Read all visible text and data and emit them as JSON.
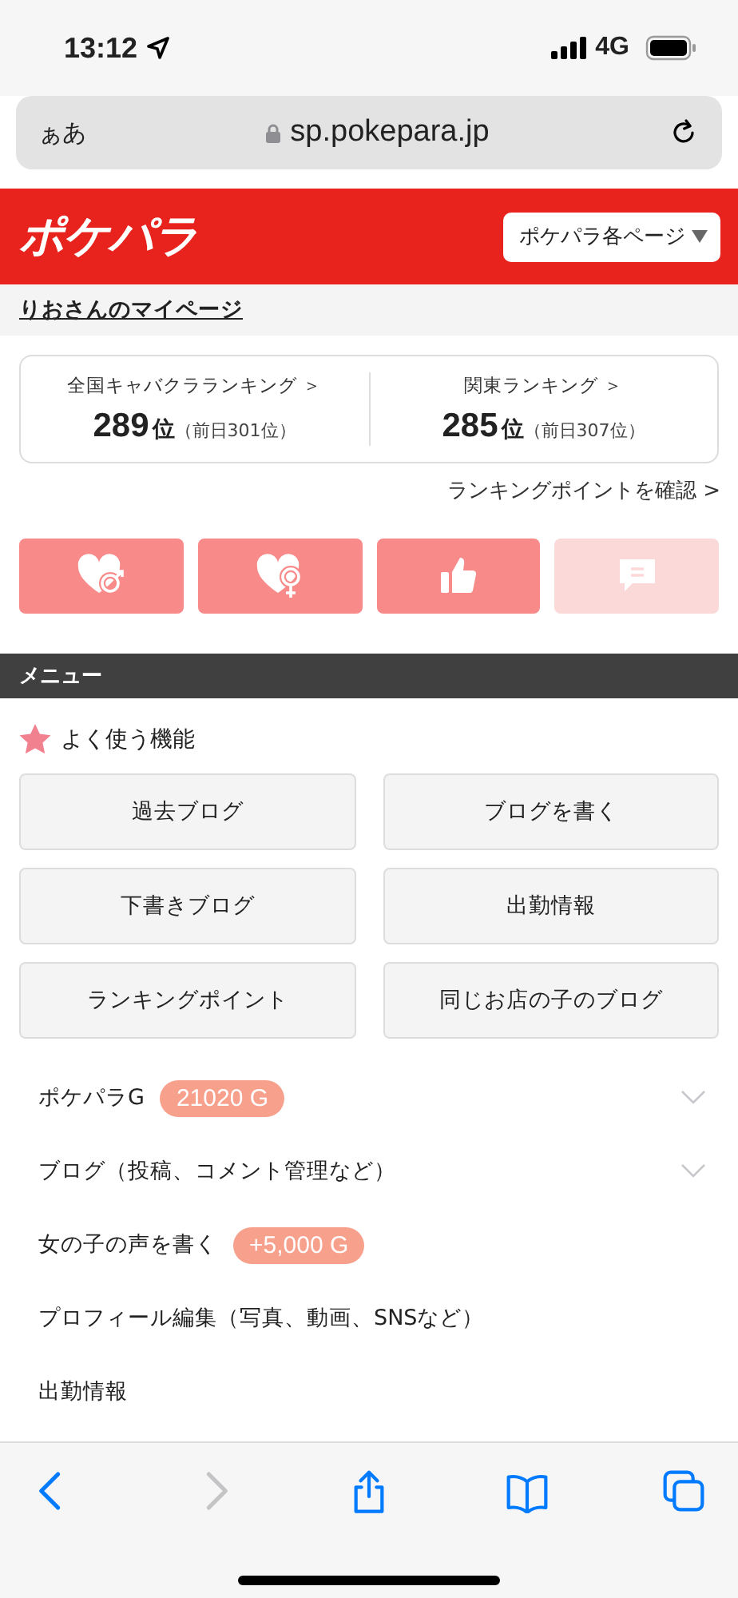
{
  "status_bar": {
    "time": "13:12",
    "network": "4G"
  },
  "address_bar": {
    "text_size": "ぁあ",
    "url": "sp.pokepara.jp"
  },
  "header": {
    "logo": "ポケパラ",
    "menu": "ポケパラ各ページ"
  },
  "page_title": "りおさんのマイページ",
  "rankings": [
    {
      "label": "全国キャバクラランキング ＞",
      "rank": "289",
      "unit": "位",
      "previous": "（前日301位）"
    },
    {
      "label": "関東ランキング ＞",
      "rank": "285",
      "unit": "位",
      "previous": "（前日307位）"
    }
  ],
  "ranking_points_link": "ランキングポイントを確認 >",
  "action_buttons": [
    {
      "disabled": false
    },
    {
      "disabled": false
    },
    {
      "disabled": false
    },
    {
      "disabled": true
    }
  ],
  "menu_heading": "メニュー",
  "favorites": {
    "title": "よく使う機能",
    "buttons": [
      "過去ブログ",
      "ブログを書く",
      "下書きブログ",
      "出勤情報",
      "ランキングポイント",
      "同じお店の子のブログ"
    ]
  },
  "menu_items": [
    {
      "label": "ポケパラG",
      "badge": "21020 G",
      "expanded": false
    },
    {
      "label": "ブログ（投稿、コメント管理など）",
      "expanded": false
    },
    {
      "label": "女の子の声を書く",
      "badge": "+5,000 G"
    },
    {
      "label": "プロフィール編集（写真、動画、SNSなど）"
    },
    {
      "label": "出勤情報"
    }
  ],
  "toolbar": [
    {
      "disabled": false
    },
    {
      "disabled": true
    },
    {
      "disabled": false
    },
    {
      "disabled": false
    },
    {
      "disabled": false
    }
  ]
}
